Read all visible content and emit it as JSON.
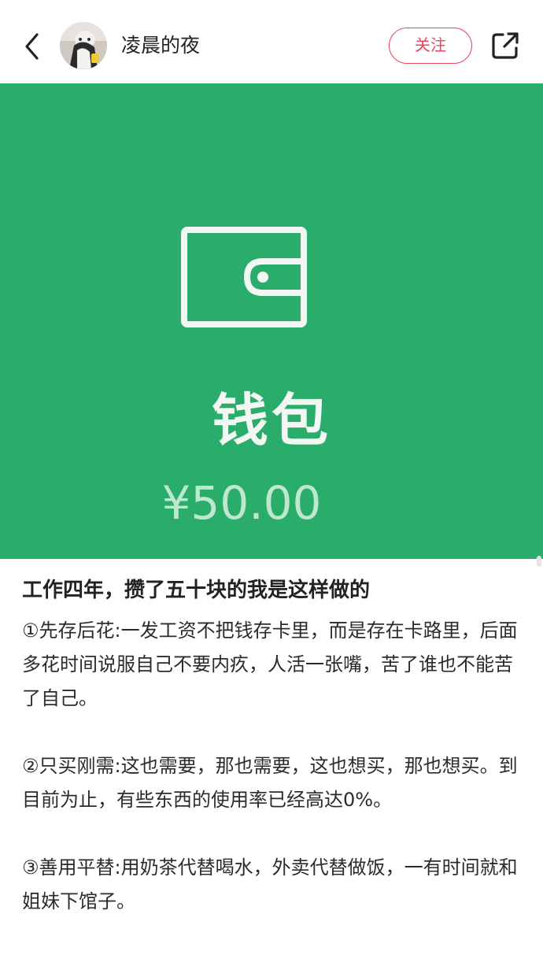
{
  "header": {
    "username": "凌晨的夜",
    "follow_label": "关注",
    "icons": {
      "back": "back-arrow-icon",
      "share": "share-icon"
    }
  },
  "hero": {
    "background": "#2aad6a",
    "title": "钱包",
    "amount": "¥50.00",
    "icon": "wallet-icon"
  },
  "post": {
    "title": "工作四年，攒了五十块的我是这样做的",
    "paragraphs": [
      "①先存后花:一发工资不把钱存卡里，而是存在卡路里，后面多花时间说服自己不要内疚，人活一张嘴，苦了谁也不能苦了自己。",
      "②只买刚需:这也需要，那也需要，这也想买，那也想买。到目前为止，有些东西的使用率已经高达0%。",
      "③善用平替:用奶茶代替喝水，外卖代替做饭，一有时间就和姐妹下馆子。"
    ]
  },
  "colors": {
    "accent": "#e9445c",
    "hero_green": "#2aad6a"
  }
}
